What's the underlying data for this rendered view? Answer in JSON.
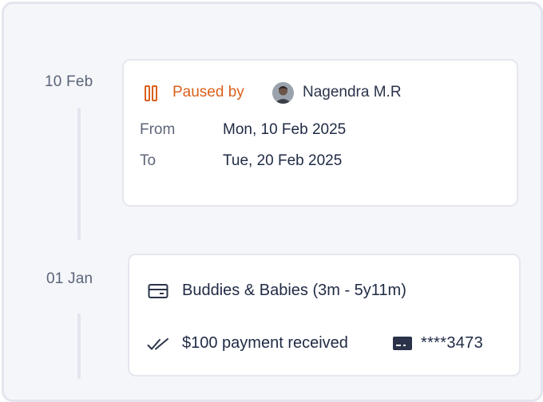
{
  "timeline": {
    "entries": [
      {
        "date": "10 Feb",
        "status": {
          "label": "Paused by",
          "color": "#d9601c",
          "icon": "pause-icon"
        },
        "user": {
          "name": "Nagendra M.R",
          "avatar": "avatar"
        },
        "rows": [
          {
            "label": "From",
            "value": "Mon, 10 Feb 2025"
          },
          {
            "label": "To",
            "value": "Tue, 20 Feb 2025"
          }
        ]
      },
      {
        "date": "01 Jan",
        "program": {
          "icon": "card-icon",
          "label": "Buddies & Babies (3m - 5y11m)"
        },
        "payment": {
          "icon": "double-check-icon",
          "label": "$100 payment received",
          "card_icon": "credit-card-icon",
          "card_number": "****3473"
        }
      }
    ]
  }
}
